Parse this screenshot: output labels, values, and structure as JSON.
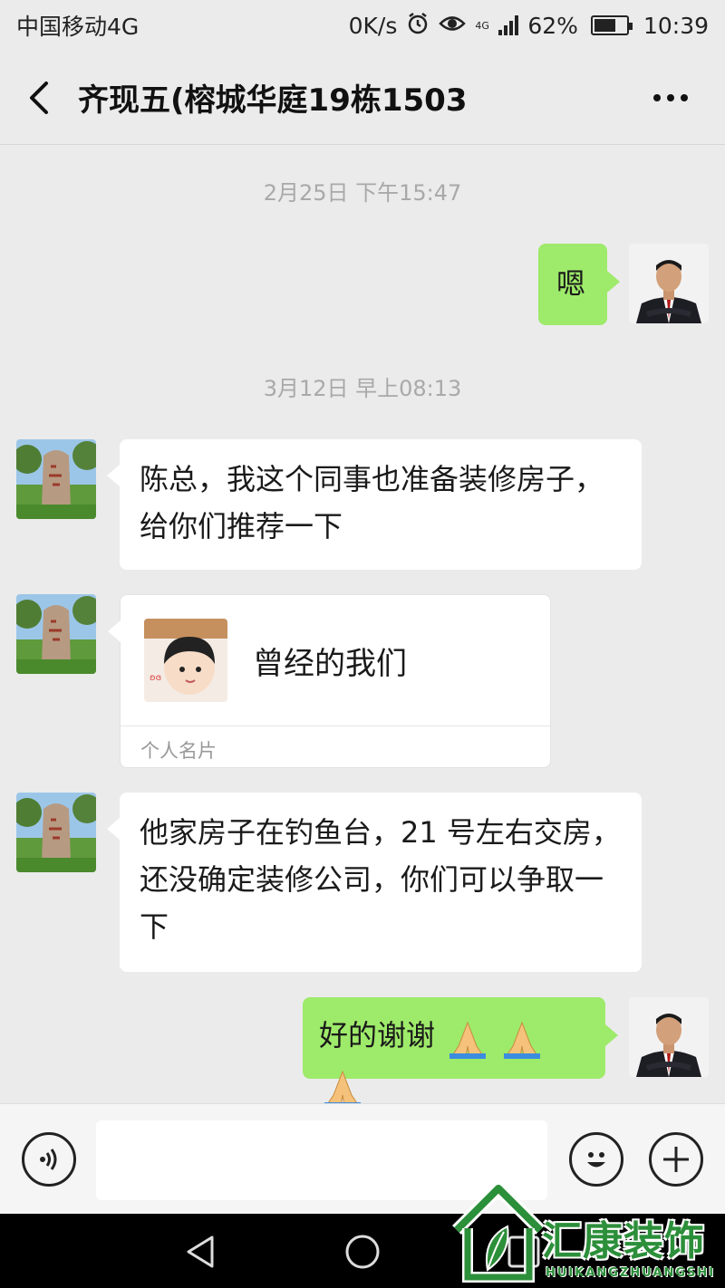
{
  "status_bar": {
    "carrier": "中国移动4G",
    "speed": "0K/s",
    "network": "4G",
    "battery": "62%",
    "time": "10:39"
  },
  "header": {
    "title": "齐现五(榕城华庭19栋1503"
  },
  "timestamps": [
    "2月25日 下午15:47",
    "3月12日 早上08:13"
  ],
  "messages": {
    "m1": "嗯",
    "m2": "陈总，我这个同事也准备装修房子，给你们推荐一下",
    "card": {
      "name": "曾经的我们",
      "type": "个人名片"
    },
    "m4": "他家房子在钓鱼台，21 号左右交房，还没确定装修公司，你们可以争取一下",
    "m5": "好的谢谢"
  },
  "input": {
    "placeholder": ""
  },
  "watermark": {
    "brand": "汇康装饰",
    "sub": "HUIKANGZHUANGSHI"
  },
  "colors": {
    "bg": "#ebebeb",
    "bubble_out": "#9eea6a",
    "bubble_in": "#ffffff",
    "brand_green": "#2c8f3a"
  },
  "icons": [
    "back-arrow-icon",
    "more-icon",
    "voice-icon",
    "emoji-icon",
    "plus-icon",
    "nav-back-icon",
    "nav-home-icon",
    "nav-recent-icon",
    "pray-emoji-icon",
    "alarm-icon",
    "eye-icon",
    "signal-icon",
    "battery-icon"
  ]
}
